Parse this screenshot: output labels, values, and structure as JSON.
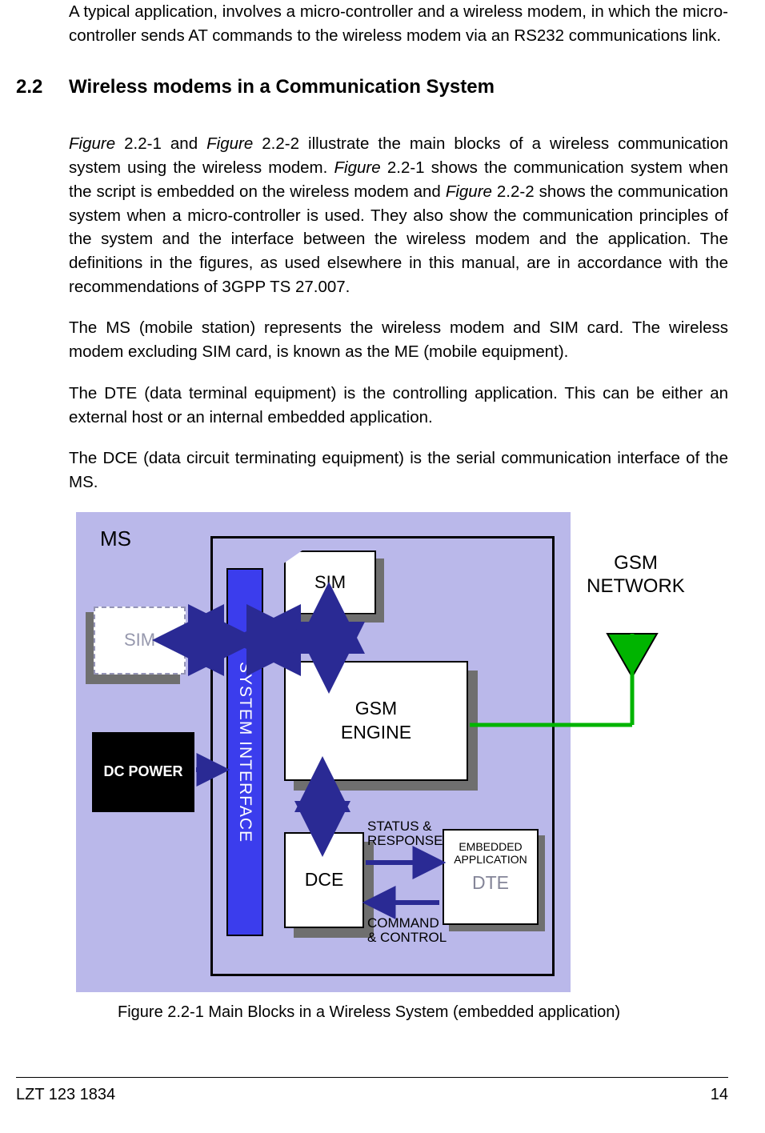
{
  "paragraphs": {
    "intro": "A typical application, involves a micro-controller and a wireless modem, in which the micro-controller sends AT commands to the wireless modem via an RS232 communications link.",
    "p1_a": "Figure",
    "p1_b": " 2.2-1 and ",
    "p1_c": "Figure",
    "p1_d": " 2.2-2 illustrate the main blocks of a wireless communication system using the wireless modem. ",
    "p1_e": "Figure",
    "p1_f": " 2.2-1 shows the communication system when the script is embedded on the wireless modem and ",
    "p1_g": "Figure",
    "p1_h": " 2.2-2 shows the communication system when a micro-controller is used. They also show the communication principles of the system and the interface between the wireless modem and the application. The definitions in the figures, as used elsewhere in this manual, are in accordance with the recommendations of 3GPP TS 27.007.",
    "p2": "The MS (mobile station) represents the wireless modem and SIM card. The wireless modem excluding SIM card, is known as the ME (mobile equipment).",
    "p3": "The DTE (data terminal equipment) is the controlling application. This can be either an external host or an internal embedded application.",
    "p4": "The DCE (data circuit terminating equipment) is the serial communication interface of the MS."
  },
  "heading": {
    "number": "2.2",
    "title": "Wireless modems in a Communication System"
  },
  "diagram": {
    "ms": "MS",
    "sim_ext": "SIM",
    "sim_int": "SIM",
    "sysif": "SYSTEM  INTERFACE",
    "gsm_engine": "GSM ENGINE",
    "dce": "DCE",
    "dte": "DTE",
    "embedded": "EMBEDDED APPLICATION",
    "dc_power": "DC POWER",
    "gsm_network": "GSM NETWORK",
    "status": "STATUS & RESPONSE",
    "command": "COMMAND & CONTROL"
  },
  "figure_caption": "Figure 2.2-1  Main Blocks in a Wireless System (embedded application)",
  "footer": {
    "doc": "LZT 123 1834",
    "page": "14"
  }
}
